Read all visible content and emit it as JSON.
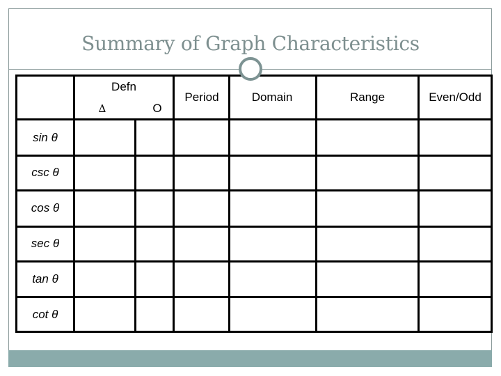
{
  "slide": {
    "title": "Summary of Graph Characteristics",
    "colors": {
      "title": "#7d8f8f",
      "accent_band": "#8aabab",
      "frame": "#8a9a9a",
      "ring": "#7d9393",
      "table_lines": "#000000"
    }
  },
  "table": {
    "header": {
      "definition_group": "Defn",
      "definition_subcols": [
        "∆",
        "O"
      ],
      "columns": [
        "Period",
        "Domain",
        "Range",
        "Even/Odd"
      ]
    },
    "rows": [
      {
        "label": "sin θ",
        "cells": [
          "",
          "",
          "",
          "",
          "",
          ""
        ]
      },
      {
        "label": "csc θ",
        "cells": [
          "",
          "",
          "",
          "",
          "",
          ""
        ]
      },
      {
        "label": "cos θ",
        "cells": [
          "",
          "",
          "",
          "",
          "",
          ""
        ]
      },
      {
        "label": "sec θ",
        "cells": [
          "",
          "",
          "",
          "",
          "",
          ""
        ]
      },
      {
        "label": "tan θ",
        "cells": [
          "",
          "",
          "",
          "",
          "",
          ""
        ]
      },
      {
        "label": "cot θ",
        "cells": [
          "",
          "",
          "",
          "",
          "",
          ""
        ]
      }
    ]
  }
}
